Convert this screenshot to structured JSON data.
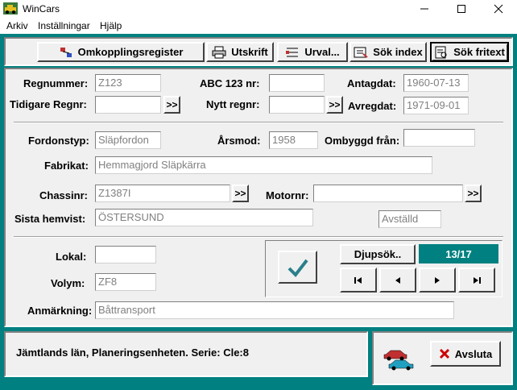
{
  "window": {
    "title": "WinCars",
    "icon": "car-icon"
  },
  "menu": [
    "Arkiv",
    "Inställningar",
    "Hjälp"
  ],
  "toolbar": {
    "omkoppling": "Omkopplingsregister",
    "utskrift": "Utskrift",
    "urval": "Urval...",
    "sok_index": "Sök index",
    "sok_fritext": "Sök fritext"
  },
  "form": {
    "regnummer_label": "Regnummer:",
    "regnummer": "Z123",
    "abc_label": "ABC 123 nr:",
    "abc": "",
    "antagdat_label": "Antagdat:",
    "antagdat": "1960-07-13",
    "tidigare_label": "Tidigare Regnr:",
    "tidigare": "",
    "nytt_label": "Nytt regnr:",
    "nytt": "",
    "avregdat_label": "Avregdat:",
    "avregdat": "1971-09-01",
    "fordonstyp_label": "Fordonstyp:",
    "fordonstyp": "Släpfordon",
    "arsmod_label": "Årsmod:",
    "arsmod": "1958",
    "ombyggd_label": "Ombyggd från:",
    "ombyggd": "",
    "fabrikat_label": "Fabrikat:",
    "fabrikat": "Hemmagjord Släpkärra",
    "chassinr_label": "Chassinr:",
    "chassinr": "Z1387I",
    "motornr_label": "Motornr:",
    "motornr": "",
    "hemvist_label": "Sista hemvist:",
    "hemvist": "ÖSTERSUND",
    "status": "Avställd",
    "lokal_label": "Lokal:",
    "lokal": "",
    "volym_label": "Volym:",
    "volym": "ZF8",
    "anmarkning_label": "Anmärkning:",
    "anmarkning": "Båttransport",
    "go_symbol": ">>"
  },
  "search": {
    "djupsok_label": "Djupsök..",
    "counter": "13/17",
    "counter_color": "#008080"
  },
  "nav": {
    "first": "first-record-icon",
    "prev": "prev-record-icon",
    "next": "next-record-icon",
    "last": "last-record-icon"
  },
  "status_bar": {
    "text": "Jämtlands län, Planeringsenheten.  Serie: Cle:8"
  },
  "footer": {
    "exit_label": "Avsluta"
  },
  "colors": {
    "frame": "#008080",
    "exit_icon": "#cc0000",
    "check_icon": "#2a7f8a"
  }
}
